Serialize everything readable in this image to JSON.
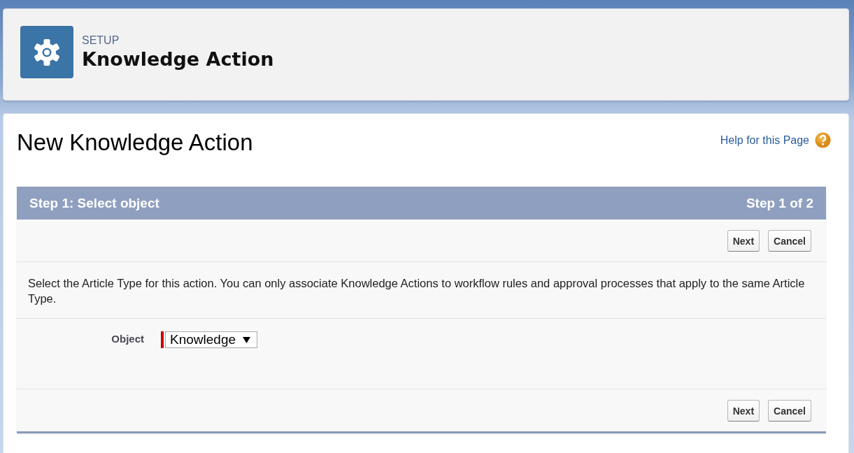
{
  "header": {
    "eyebrow": "SETUP",
    "title": "Knowledge Action"
  },
  "page": {
    "title": "New Knowledge Action",
    "help_link": "Help for this Page"
  },
  "wizard": {
    "step_title": "Step 1: Select object",
    "step_count": "Step 1 of 2",
    "top_buttons": [
      "Next",
      "Cancel"
    ],
    "description": "Select the Article Type for this action. You can only associate Knowledge Actions to workflow rules and approval processes that apply to the same Article Type.",
    "fields": [
      {
        "label": "Object",
        "value": "Knowledge",
        "required": true
      }
    ],
    "bottom_buttons": [
      "Next",
      "Cancel"
    ]
  }
}
